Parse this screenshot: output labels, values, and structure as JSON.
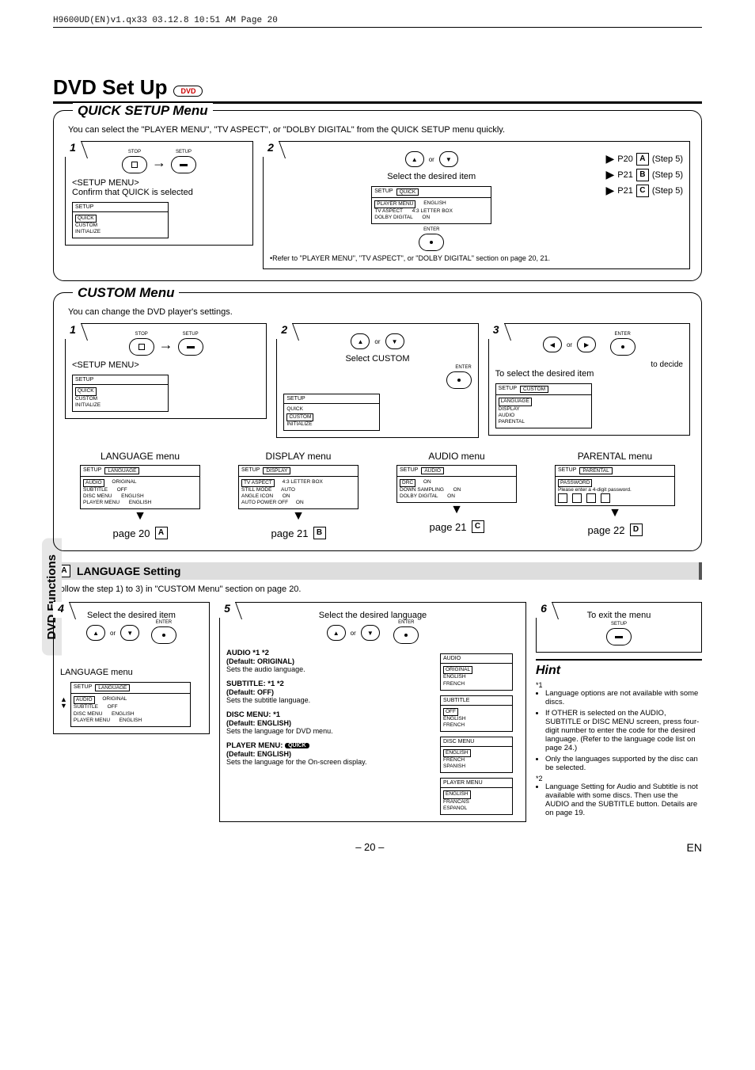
{
  "runhead": "H9600UD(EN)v1.qx33  03.12.8  10:51 AM  Page 20",
  "title": "DVD Set Up",
  "dvd_badge": "DVD",
  "side_tab": "DVD Functions",
  "quick": {
    "title": "QUICK SETUP Menu",
    "intro": "You can select the \"PLAYER MENU\", \"TV ASPECT\", or \"DOLBY DIGITAL\" from the QUICK SETUP menu quickly.",
    "step1": {
      "num": "1",
      "stop": "STOP",
      "setup": "SETUP",
      "heading": "<SETUP MENU>",
      "confirm": "Confirm that QUICK is selected",
      "menu_hdr": "SETUP",
      "menu_items": [
        "QUICK",
        "CUSTOM",
        "INITIALIZE"
      ]
    },
    "step2": {
      "num": "2",
      "or": "or",
      "select": "Select the desired item",
      "enter": "ENTER",
      "menu_hdr": "SETUP",
      "menu_sel": "QUICK",
      "rows": [
        {
          "l": "PLAYER MENU",
          "r": "ENGLISH"
        },
        {
          "l": "TV ASPECT",
          "r": "4:3 LETTER BOX"
        },
        {
          "l": "DOLBY DIGITAL",
          "r": "ON"
        }
      ],
      "links": [
        {
          "p": "P20",
          "l": "A",
          "s": "(Step 5)"
        },
        {
          "p": "P21",
          "l": "B",
          "s": "(Step 5)"
        },
        {
          "p": "P21",
          "l": "C",
          "s": "(Step 5)"
        }
      ],
      "note": "•Refer to \"PLAYER MENU\", \"TV ASPECT\", or \"DOLBY DIGITAL\" section on page 20, 21."
    }
  },
  "custom": {
    "title": "CUSTOM Menu",
    "intro": "You can change the DVD player's settings.",
    "step1": {
      "num": "1",
      "heading": "<SETUP MENU>",
      "stop": "STOP",
      "setup": "SETUP",
      "menu_hdr": "SETUP",
      "menu_items": [
        "QUICK",
        "CUSTOM",
        "INITIALIZE"
      ]
    },
    "step2": {
      "num": "2",
      "or": "or",
      "select": "Select CUSTOM",
      "enter": "ENTER",
      "menu_hdr": "SETUP",
      "menu_items": [
        "QUICK",
        "CUSTOM",
        "INITIALIZE"
      ]
    },
    "step3": {
      "num": "3",
      "or": "or",
      "enter": "ENTER",
      "decide": "to decide",
      "select": "To select the desired item",
      "menu_hdr": "SETUP",
      "menu_sel": "CUSTOM",
      "menu_items": [
        "LANGUAGE",
        "DISPLAY",
        "AUDIO",
        "PARENTAL"
      ]
    },
    "flow": {
      "lang": {
        "lbl": "LANGUAGE menu",
        "hdr": "SETUP",
        "sel": "LANGUAGE",
        "rows": [
          [
            "AUDIO",
            "ORIGINAL"
          ],
          [
            "SUBTITLE",
            "OFF"
          ],
          [
            "DISC MENU",
            "ENGLISH"
          ],
          [
            "PLAYER MENU",
            "ENGLISH"
          ]
        ],
        "page": "page 20",
        "letter": "A"
      },
      "disp": {
        "lbl": "DISPLAY menu",
        "hdr": "SETUP",
        "sel": "DISPLAY",
        "rows": [
          [
            "TV ASPECT",
            "4:3 LETTER BOX"
          ],
          [
            "STILL MODE",
            "AUTO"
          ],
          [
            "ANGLE ICON",
            "ON"
          ],
          [
            "AUTO POWER OFF",
            "ON"
          ]
        ],
        "page": "page 21",
        "letter": "B"
      },
      "audio": {
        "lbl": "AUDIO menu",
        "hdr": "SETUP",
        "sel": "AUDIO",
        "rows": [
          [
            "DRC",
            "ON"
          ],
          [
            "DOWN SAMPLING",
            "ON"
          ],
          [
            "DOLBY DIGITAL",
            "ON"
          ]
        ],
        "page": "page 21",
        "letter": "C"
      },
      "parental": {
        "lbl": "PARENTAL menu",
        "hdr": "SETUP",
        "sel": "PARENTAL",
        "pwd_label": "PASSWORD",
        "pwd_text": "Please enter a 4-digit password.",
        "page": "page 22",
        "letter": "D"
      }
    }
  },
  "lang_setting": {
    "letter": "A",
    "label": "LANGUAGE Setting",
    "follow": "Follow the step 1) to 3) in \"CUSTOM Menu\" section on page 20.",
    "step4": {
      "num": "4",
      "select": "Select the desired item",
      "or": "or",
      "enter": "ENTER",
      "menu_lbl": "LANGUAGE menu",
      "hdr": "SETUP",
      "sel": "LANGUAGE",
      "rows": [
        [
          "AUDIO",
          "ORIGINAL"
        ],
        [
          "SUBTITLE",
          "OFF"
        ],
        [
          "DISC MENU",
          "ENGLISH"
        ],
        [
          "PLAYER MENU",
          "ENGLISH"
        ]
      ]
    },
    "step5": {
      "num": "5",
      "select": "Select the desired language",
      "or": "or",
      "enter": "ENTER",
      "items": [
        {
          "title": "AUDIO *1 *2",
          "def": "(Default: ORIGINAL)",
          "desc": "Sets the audio language.",
          "opts_hdr": "AUDIO",
          "opts": [
            "ORIGINAL",
            "ENGLISH",
            "FRENCH"
          ]
        },
        {
          "title": "SUBTITLE: *1 *2",
          "def": "(Default: OFF)",
          "desc": "Sets the subtitle language.",
          "opts_hdr": "SUBTITLE",
          "opts": [
            "OFF",
            "ENGLISH",
            "FRENCH"
          ]
        },
        {
          "title": "DISC MENU: *1",
          "def": "(Default: ENGLISH)",
          "desc": "Sets the language for DVD menu.",
          "opts_hdr": "DISC MENU",
          "opts": [
            "ENGLISH",
            "FRENCH",
            "SPANISH"
          ]
        },
        {
          "title": "PLAYER MENU:",
          "badge": "QUICK",
          "def": "(Default: ENGLISH)",
          "desc": "Sets the language for the On-screen display.",
          "opts_hdr": "PLAYER MENU",
          "opts": [
            "ENGLISH",
            "FRANCAIS",
            "ESPANOL"
          ]
        }
      ]
    },
    "step6": {
      "num": "6",
      "select": "To exit the menu",
      "setup": "SETUP"
    },
    "hint": {
      "title": "Hint",
      "n1": "*1",
      "b1": "Language options are not available with some discs.",
      "b2": "If OTHER is selected on the AUDIO, SUBTITLE or DISC MENU screen, press four-digit number to enter the code for the desired language. (Refer to the language code list on page 24.)",
      "b3": "Only the languages supported by the disc can be selected.",
      "n2": "*2",
      "b4": "Language Setting for Audio and Subtitle is not available with some discs. Then use the AUDIO and the SUBTITLE button. Details are on page 19."
    }
  },
  "footer": {
    "page": "– 20 –",
    "lang": "EN"
  }
}
